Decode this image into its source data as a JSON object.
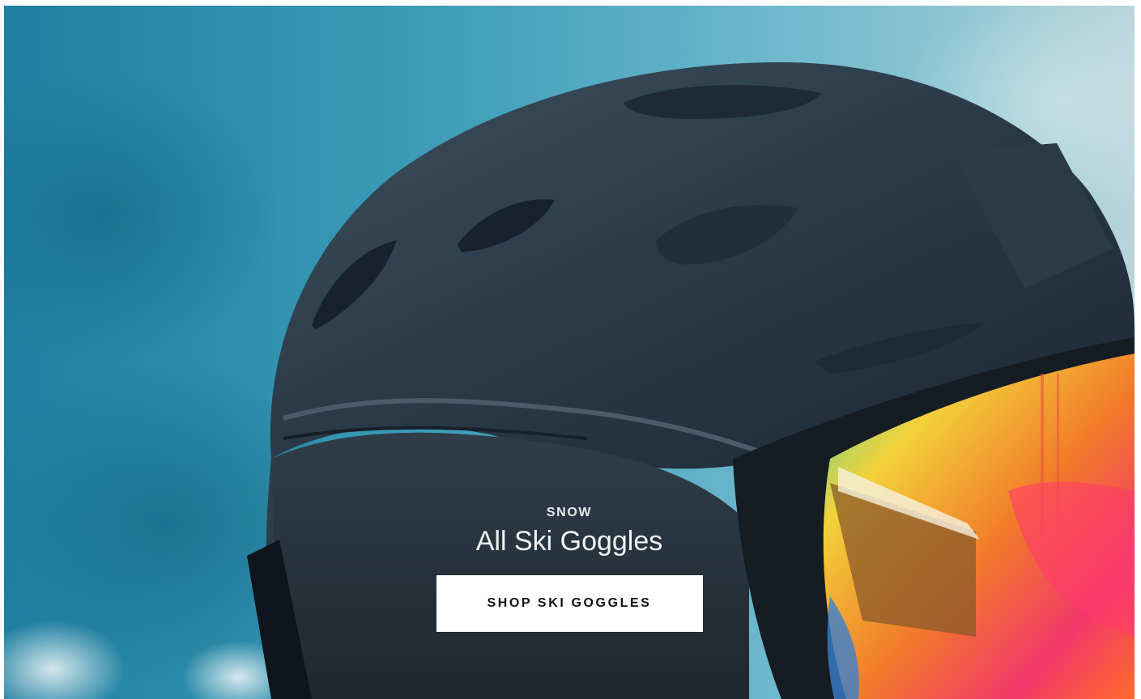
{
  "hero": {
    "eyebrow": "SNOW",
    "title": "All Ski Goggles",
    "cta_label": "SHOP SKI GOGGLES",
    "image_subject": "ski-helmet-with-mirrored-goggles",
    "colors": {
      "sky": "#3a9ab6",
      "helmet": "#2a3a48",
      "cta_bg": "#ffffff",
      "cta_text": "#111111",
      "text": "#f0f2f4"
    }
  }
}
